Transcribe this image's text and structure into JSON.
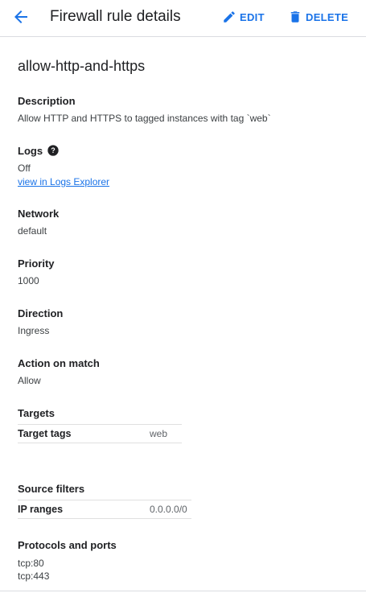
{
  "header": {
    "title": "Firewall rule details",
    "edit_label": "EDIT",
    "delete_label": "DELETE"
  },
  "rule": {
    "name": "allow-http-and-https",
    "description_label": "Description",
    "description": "Allow HTTP and HTTPS to tagged instances with tag `web`",
    "logs_label": "Logs",
    "logs_value": "Off",
    "logs_link": "view in Logs Explorer",
    "network_label": "Network",
    "network_value": "default",
    "priority_label": "Priority",
    "priority_value": "1000",
    "direction_label": "Direction",
    "direction_value": "Ingress",
    "action_label": "Action on match",
    "action_value": "Allow",
    "targets_label": "Targets",
    "target_tags_key": "Target tags",
    "target_tags_value": "web",
    "source_filters_label": "Source filters",
    "ip_ranges_key": "IP ranges",
    "ip_ranges_value": "0.0.0.0/0",
    "protocols_label": "Protocols and ports",
    "protocols": [
      "tcp:80",
      "tcp:443"
    ]
  },
  "colors": {
    "accent": "#1a73e8",
    "text": "#202124",
    "divider": "#dadce0"
  },
  "icons": {
    "back": "arrow-back-icon",
    "edit": "pencil-icon",
    "delete": "trash-icon",
    "help": "help-circle-icon"
  }
}
